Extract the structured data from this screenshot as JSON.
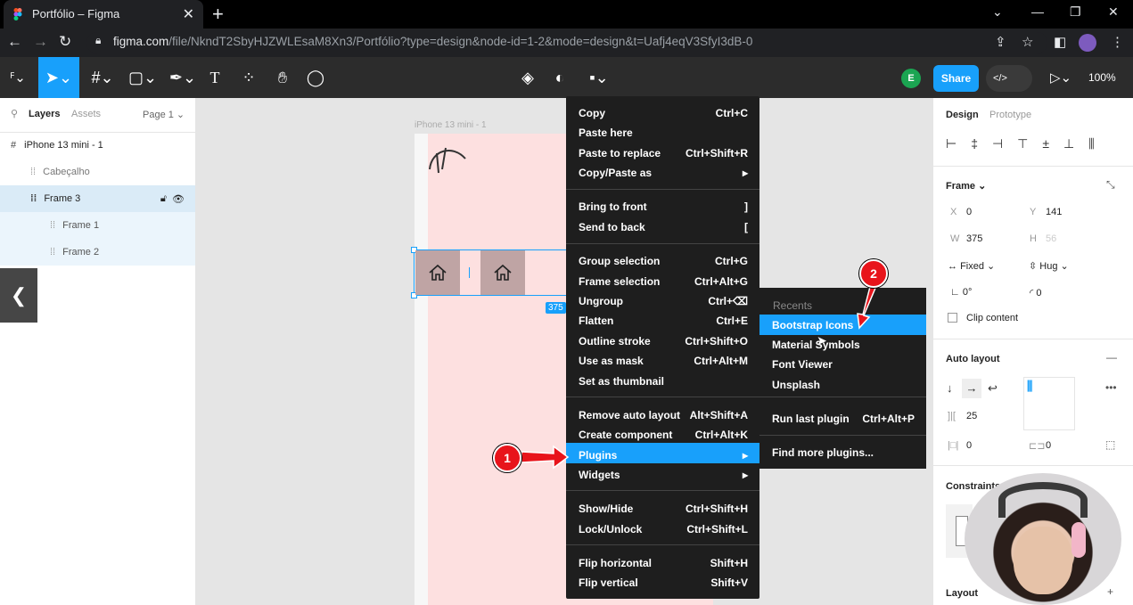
{
  "browser": {
    "tab_title": "Portfólio – Figma",
    "url_host": "figma.com",
    "url_path": "/file/NkndT2SbyHJZWLEsaM8Xn3/Portfólio?type=design&node-id=1-2&mode=design&t=Uafj4eqV3SfyI3dB-0"
  },
  "toolbar": {
    "share_label": "Share",
    "avatar_letter": "E",
    "zoom": "100%",
    "dev_label": "</>"
  },
  "layers_panel": {
    "tab_layers": "Layers",
    "tab_assets": "Assets",
    "page": "Page 1",
    "items": [
      {
        "label": "iPhone 13 mini - 1"
      },
      {
        "label": "Cabeçalho"
      },
      {
        "label": "Frame 3"
      },
      {
        "label": "Frame 1"
      },
      {
        "label": "Frame 2"
      }
    ]
  },
  "canvas": {
    "frame_title": "iPhone 13 mini - 1",
    "dimension_badge": "375"
  },
  "context_menu": {
    "items": [
      {
        "label": "Copy",
        "shortcut": "Ctrl+C"
      },
      {
        "label": "Paste here",
        "shortcut": ""
      },
      {
        "label": "Paste to replace",
        "shortcut": "Ctrl+Shift+R"
      },
      {
        "label": "Copy/Paste as",
        "shortcut": "▸"
      },
      {
        "label": "Bring to front",
        "shortcut": "]"
      },
      {
        "label": "Send to back",
        "shortcut": "["
      },
      {
        "label": "Group selection",
        "shortcut": "Ctrl+G"
      },
      {
        "label": "Frame selection",
        "shortcut": "Ctrl+Alt+G"
      },
      {
        "label": "Ungroup",
        "shortcut": "Ctrl+⌫"
      },
      {
        "label": "Flatten",
        "shortcut": "Ctrl+E"
      },
      {
        "label": "Outline stroke",
        "shortcut": "Ctrl+Shift+O"
      },
      {
        "label": "Use as mask",
        "shortcut": "Ctrl+Alt+M"
      },
      {
        "label": "Set as thumbnail",
        "shortcut": ""
      },
      {
        "label": "Remove auto layout",
        "shortcut": "Alt+Shift+A"
      },
      {
        "label": "Create component",
        "shortcut": "Ctrl+Alt+K"
      },
      {
        "label": "Plugins",
        "shortcut": "▸"
      },
      {
        "label": "Widgets",
        "shortcut": "▸"
      },
      {
        "label": "Show/Hide",
        "shortcut": "Ctrl+Shift+H"
      },
      {
        "label": "Lock/Unlock",
        "shortcut": "Ctrl+Shift+L"
      },
      {
        "label": "Flip horizontal",
        "shortcut": "Shift+H"
      },
      {
        "label": "Flip vertical",
        "shortcut": "Shift+V"
      }
    ]
  },
  "plugins_submenu": {
    "header": "Recents",
    "items": [
      {
        "label": "Bootstrap Icons",
        "shortcut": ""
      },
      {
        "label": "Material Symbols",
        "shortcut": ""
      },
      {
        "label": "Font Viewer",
        "shortcut": ""
      },
      {
        "label": "Unsplash",
        "shortcut": ""
      },
      {
        "label": "Run last plugin",
        "shortcut": "Ctrl+Alt+P"
      },
      {
        "label": "Find more plugins...",
        "shortcut": ""
      }
    ]
  },
  "design_panel": {
    "tab_design": "Design",
    "tab_prototype": "Prototype",
    "frame_label": "Frame",
    "x_label": "X",
    "x_value": "0",
    "y_label": "Y",
    "y_value": "141",
    "w_label": "W",
    "w_value": "375",
    "h_label": "H",
    "h_value": "56",
    "width_mode": "Fixed",
    "height_mode": "Hug",
    "rotation": "0°",
    "radius": "0",
    "clip_content": "Clip content",
    "auto_layout": "Auto layout",
    "spacing": "25",
    "padding_h": "0",
    "padding_v": "0",
    "constraints": "Constraints",
    "layout_grid": "Layout"
  },
  "annotations": {
    "badge1": "1",
    "badge2": "2"
  },
  "colors": {
    "accent": "#18a0fb",
    "menu_bg": "#1e1e1e",
    "annotation_red": "#e8141b"
  }
}
